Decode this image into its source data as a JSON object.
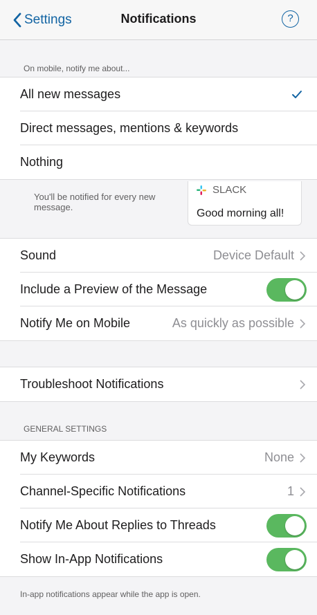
{
  "nav": {
    "back_label": "Settings",
    "title": "Notifications",
    "help_glyph": "?"
  },
  "mobile_section": {
    "header": "On mobile, notify me about...",
    "options": [
      {
        "label": "All new messages",
        "selected": true
      },
      {
        "label": "Direct messages, mentions & keywords",
        "selected": false
      },
      {
        "label": "Nothing",
        "selected": false
      }
    ]
  },
  "preview": {
    "description": "You'll be notified for every new message.",
    "app_name": "SLACK",
    "message": "Good morning all!"
  },
  "sound_group": {
    "sound_label": "Sound",
    "sound_value": "Device Default",
    "preview_label": "Include a Preview of the Message",
    "preview_on": true,
    "notify_mobile_label": "Notify Me on Mobile",
    "notify_mobile_value": "As quickly as possible"
  },
  "troubleshoot": {
    "label": "Troubleshoot Notifications"
  },
  "general": {
    "header": "GENERAL SETTINGS",
    "keywords_label": "My Keywords",
    "keywords_value": "None",
    "channel_label": "Channel-Specific Notifications",
    "channel_value": "1",
    "replies_label": "Notify Me About Replies to Threads",
    "replies_on": true,
    "inapp_label": "Show In-App Notifications",
    "inapp_on": true
  },
  "footer_note": "In-app notifications appear while the app is open.",
  "colors": {
    "accent": "#1264a3",
    "toggle_on": "#5ab85f",
    "background": "#f4f4f6"
  },
  "icons": [
    "chevron-left-icon",
    "help-icon",
    "checkmark-icon",
    "slack-logo-icon",
    "chevron-right-icon"
  ]
}
